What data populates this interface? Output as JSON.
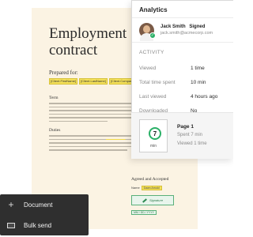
{
  "document": {
    "title_line1": "Employment",
    "title_line2": "contract",
    "prepared_for": "Prepared for:",
    "fields": [
      "[Client.FirstName]",
      "[Client.LastName]",
      "[Client.Company]"
    ],
    "section_term": "Term",
    "section_duties": "Duties",
    "agreed": "Agreed and Accepted",
    "name_label": "Name",
    "name_value": "Dawn Arnold",
    "signature_label": "Signature",
    "date_value": "MM / DD / YYYY"
  },
  "analytics": {
    "title": "Analytics",
    "signer": {
      "name": "Jack Smith",
      "status": "Signed",
      "email": "jack.smith@acmecorp.com"
    },
    "activity_heading": "ACTIVITY",
    "stats": [
      {
        "label": "Viewed",
        "value": "1 time"
      },
      {
        "label": "Total time spent",
        "value": "10 min"
      },
      {
        "label": "Last viewed",
        "value": "4 hours ago"
      },
      {
        "label": "Downloaded",
        "value": "No"
      }
    ],
    "page": {
      "title": "Page 1",
      "timer_value": "7",
      "timer_unit": "min",
      "spent": "Spent 7 min",
      "viewed": "Viewed 1 time"
    },
    "colors": {
      "accent": "#2bb067"
    }
  },
  "menu": {
    "items": [
      {
        "label": "Document",
        "icon": "plus-icon"
      },
      {
        "label": "Bulk send",
        "icon": "envelope-icon"
      }
    ]
  }
}
